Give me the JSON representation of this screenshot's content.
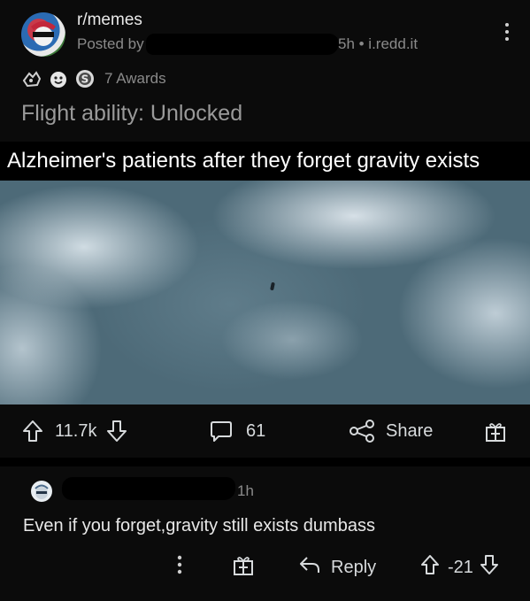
{
  "post": {
    "subreddit": "r/memes",
    "posted_by_prefix": "Posted by",
    "meta_suffix": "5h • i.redd.it",
    "awards_label": "7 Awards",
    "title": "Flight ability: Unlocked"
  },
  "media": {
    "caption": "Alzheimer's patients after they forget gravity exists"
  },
  "actions": {
    "upvotes": "11.7k",
    "comments": "61",
    "share": "Share"
  },
  "comment": {
    "time": "1h",
    "text": "Even if you forget,gravity still exists dumbass",
    "reply": "Reply",
    "score": "-21"
  },
  "icons": [
    "award-icon",
    "gold-award-icon",
    "upvote-icon",
    "downvote-icon",
    "comment-icon",
    "share-icon",
    "gift-icon",
    "reply-icon",
    "more-icon"
  ],
  "colors": {
    "background": "#0b0b0b",
    "text": "#d7dadc",
    "muted": "#8a8a8a"
  }
}
